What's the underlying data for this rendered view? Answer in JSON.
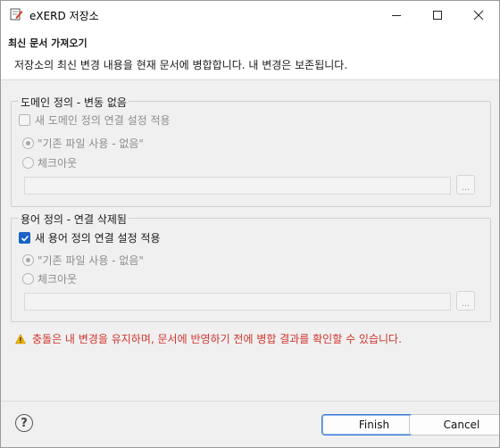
{
  "window": {
    "title": "eXERD 저장소",
    "controls": [
      "minimize",
      "maximize",
      "close"
    ]
  },
  "banner": {
    "title": "최신 문서 가져오기",
    "description": "저장소의 최신 변경 내용을 현재 문서에 병합합니다. 내 변경은 보존됩니다."
  },
  "domain_group": {
    "title": "도메인 정의 - 변동 없음",
    "checkbox_label": "새 도메인 정의 연결 설정 적용",
    "checkbox_checked": false,
    "radio_existing": "\"기존 파일 사용 - 없음\"",
    "radio_checkout": "체크아웃",
    "path_value": "",
    "browse_label": "..."
  },
  "term_group": {
    "title": "용어 정의 - 연결 삭제됨",
    "checkbox_label": "새 용어 정의 연결 설정 적용",
    "checkbox_checked": true,
    "radio_existing": "\"기존 파일 사용 - 없음\"",
    "radio_checkout": "체크아웃",
    "path_value": "",
    "browse_label": "..."
  },
  "warning": {
    "icon": "warning-triangle-icon",
    "text": "충돌은 내 변경을 유지하며, 문서에 반영하기 전에 병합 결과를 확인할 수 있습니다.",
    "color": "#d1342c"
  },
  "footer": {
    "help_icon": "?",
    "finish_label": "Finish",
    "cancel_label": "Cancel"
  },
  "colors": {
    "accent": "#1a63c4",
    "warning": "#d1342c"
  }
}
